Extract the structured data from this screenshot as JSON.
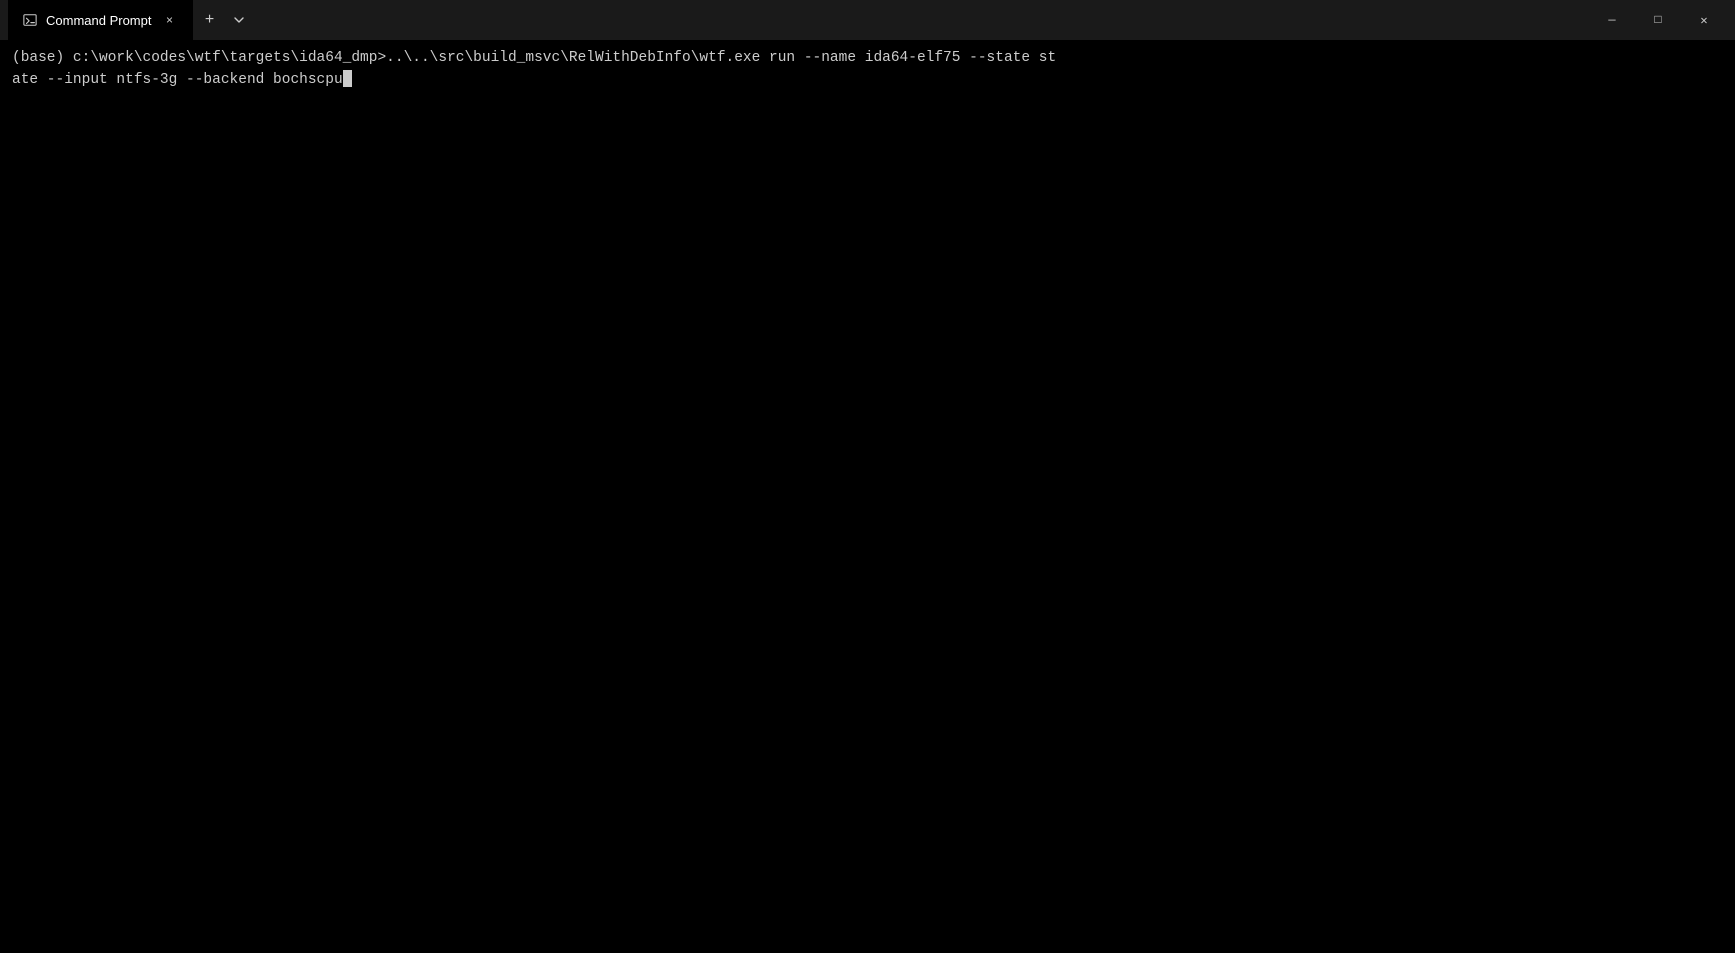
{
  "titlebar": {
    "tab_label": "Command Prompt",
    "close_tab_label": "×",
    "new_tab_label": "+",
    "dropdown_label": "⌄",
    "minimize_label": "—",
    "maximize_label": "□",
    "close_label": "✕"
  },
  "terminal": {
    "line1": "(base) c:\\work\\codes\\wtf\\targets\\ida64_dmp>..\\..\\src\\build_msvc\\RelWithDebInfo\\wtf.exe run --name ida64-elf75 --state st",
    "line2": "ate --input ntfs-3g --backend bochscpu"
  }
}
